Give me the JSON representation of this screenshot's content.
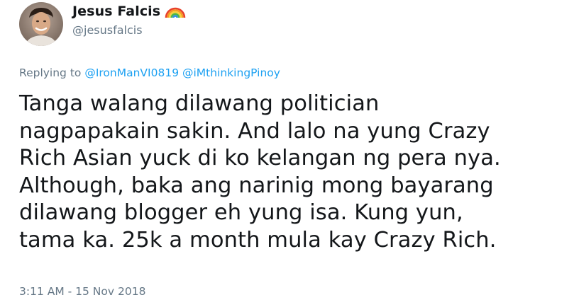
{
  "author": {
    "display_name": "Jesus Falcis",
    "handle": "@jesusfalcis",
    "badge_icon": "rainbow-emoji",
    "avatar_icon": "profile-photo"
  },
  "reply": {
    "prefix": "Replying to",
    "mentions": [
      "@IronManVI0819",
      "@iMthinkingPinoy"
    ]
  },
  "tweet": {
    "lines": [
      "Tanga walang dilawang politician",
      "nagpapakain sakin. And lalo na yung Crazy",
      "Rich Asian yuck di ko kelangan ng pera nya.",
      "Although, baka ang narinig mong bayarang",
      "dilawang blogger eh yung isa. Kung yun,",
      "tama ka. 25k a month mula kay Crazy Rich."
    ],
    "timestamp": "3:11 AM - 15 Nov 2018"
  },
  "colors": {
    "text": "#14171a",
    "muted": "#657786",
    "link": "#1da1f2"
  }
}
